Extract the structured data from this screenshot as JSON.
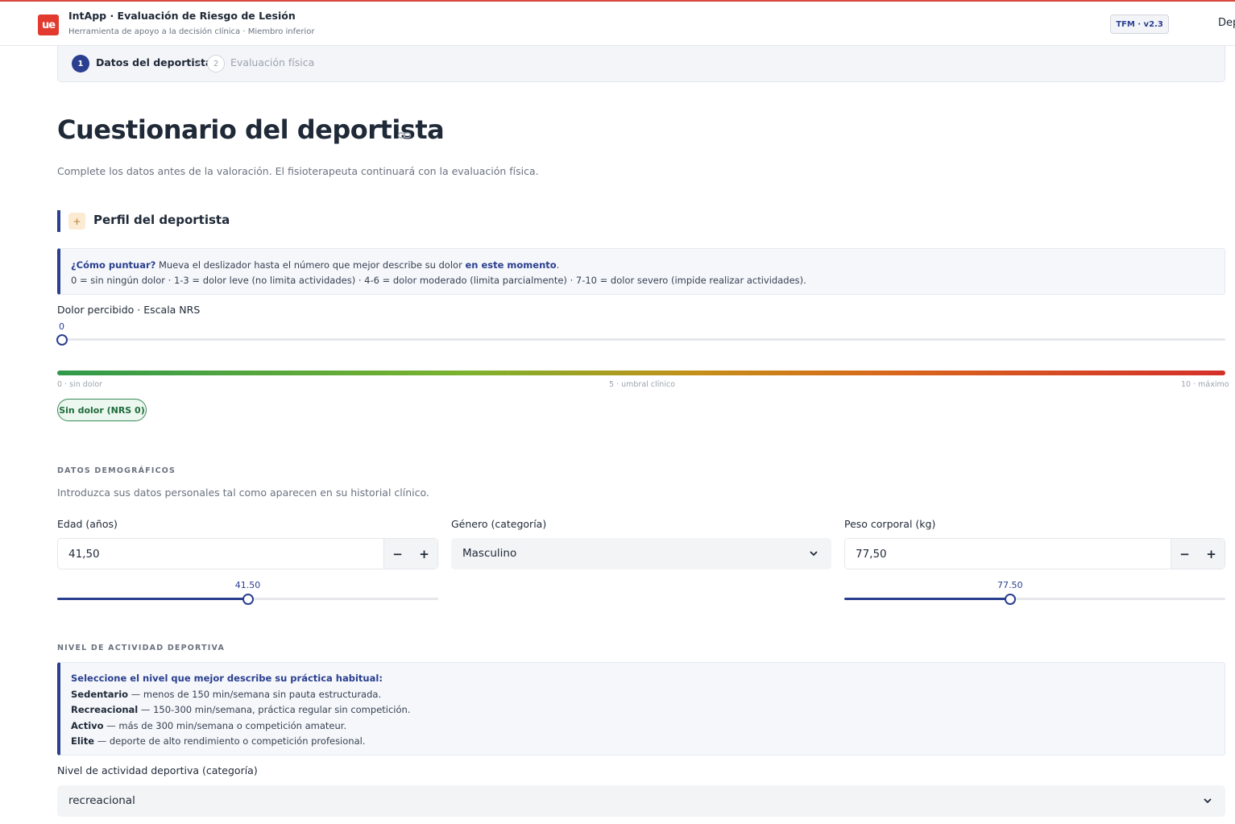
{
  "header": {
    "logo_text": "ue",
    "app_title": "IntApp · Evaluación de Riesgo de Lesión",
    "app_subtitle": "Herramienta de apoyo a la decisión clínica · Miembro inferior",
    "version": "TFM · v2.3",
    "right_text": "Dep"
  },
  "stepper": {
    "steps": [
      {
        "num": "1",
        "label": "Datos del deportista"
      },
      {
        "num": "2",
        "label": "Evaluación física"
      }
    ]
  },
  "page": {
    "title": "Cuestionario del deportista",
    "description": "Complete los datos antes de la valoración. El fisioterapeuta continuará con la evaluación física."
  },
  "section": {
    "title": "Perfil del deportista",
    "icon": "+"
  },
  "nrs_help": {
    "q": "¿Cómo puntuar?",
    "text1": " Mueva el deslizador hasta el número que mejor describe su dolor ",
    "emph": "en este momento",
    "text2": ".",
    "line2": "0 = sin ningún dolor  ·  1-3 = dolor leve (no limita actividades)  ·  4-6 = dolor moderado (limita parcialmente)  ·  7-10 = dolor severo (impide realizar actividades)."
  },
  "nrs": {
    "label": "Dolor percibido · Escala NRS",
    "value": "0",
    "fraction": 0,
    "scale_left": "0 · sin dolor",
    "scale_mid": "5 · umbral clínico",
    "scale_right": "10 · máximo",
    "badge": "Sin dolor (NRS 0)",
    "badge_color": "#3a8a56"
  },
  "demographics": {
    "heading": "DATOS DEMOGRÁFICOS",
    "description": "Introduzca sus datos personales tal como aparecen en su historial clínico.",
    "age": {
      "label": "Edad (años)",
      "value": "41,50",
      "slider_value": "41.50",
      "fraction": 0.5
    },
    "gender": {
      "label": "Género (categoría)",
      "value": "Masculino"
    },
    "weight": {
      "label": "Peso corporal (kg)",
      "value": "77,50",
      "slider_value": "77.50",
      "fraction": 0.435
    },
    "minus": "−",
    "plus": "+"
  },
  "activity": {
    "heading": "NIVEL DE ACTIVIDAD DEPORTIVA",
    "help_title": "Seleccione el nivel que mejor describe su práctica habitual:",
    "levels": [
      {
        "name": "Sedentario",
        "desc": " — menos de 150 min/semana sin pauta estructurada."
      },
      {
        "name": "Recreacional",
        "desc": " — 150-300 min/semana, práctica regular sin competición."
      },
      {
        "name": "Activo",
        "desc": " — más de 300 min/semana o competición amateur."
      },
      {
        "name": "Elite",
        "desc": " — deporte de alto rendimiento o competición profesional."
      }
    ],
    "select_label": "Nivel de actividad deportiva (categoría)",
    "select_value": "recreacional"
  },
  "colors": {
    "accent": "#2a3f8f",
    "brand_red": "#e23a2f"
  }
}
